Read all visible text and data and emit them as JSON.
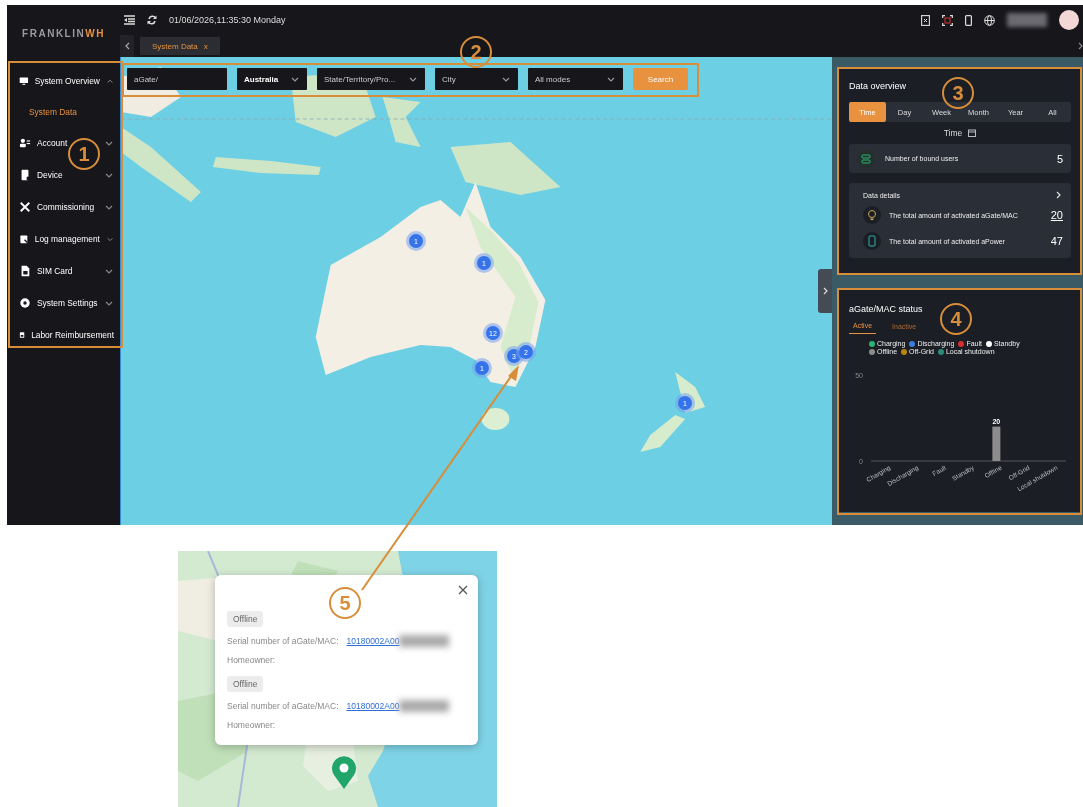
{
  "header": {
    "logo_text": "FRANKLIN",
    "logo_accent": "WH",
    "datetime": "01/06/2026,11:35:30 Monday"
  },
  "tabs": [
    {
      "label": "System Data",
      "close": "x",
      "selected": true
    }
  ],
  "sidebar": {
    "items": [
      {
        "kind": "monitor",
        "label": "System Overview",
        "expanded": true,
        "children": [
          {
            "label": "System Data",
            "selected": true
          }
        ]
      },
      {
        "kind": "account",
        "label": "Account",
        "expanded": false
      },
      {
        "kind": "device",
        "label": "Device",
        "expanded": false
      },
      {
        "kind": "tools",
        "label": "Commissioning",
        "expanded": false
      },
      {
        "kind": "log",
        "label": "Log management",
        "expanded": false
      },
      {
        "kind": "sim",
        "label": "SIM Card",
        "expanded": false
      },
      {
        "kind": "gear",
        "label": "System Settings",
        "expanded": false
      },
      {
        "kind": "receipt",
        "label": "Labor Reimbursement"
      }
    ]
  },
  "filters": {
    "search": {
      "value": "aGate/"
    },
    "selects": [
      {
        "value": "Australia"
      },
      {
        "placeholder": "State/Territory/Pro..."
      },
      {
        "placeholder": "City"
      },
      {
        "placeholder": "All modes"
      }
    ],
    "button": "Search"
  },
  "map": {
    "clusters": [
      {
        "count": "1"
      },
      {
        "count": "1"
      },
      {
        "count": "12"
      },
      {
        "count": "3"
      },
      {
        "count": "2"
      },
      {
        "count": "1"
      },
      {
        "count": "1"
      }
    ]
  },
  "data_overview": {
    "title": "Data overview",
    "periods": [
      {
        "label": "Time",
        "selected": true
      },
      {
        "label": "Day",
        "selected": false
      },
      {
        "label": "Week",
        "selected": false
      },
      {
        "label": "Month",
        "selected": false
      },
      {
        "label": "Year",
        "selected": false
      },
      {
        "label": "All",
        "selected": false
      }
    ],
    "period_label": "Time",
    "bound_users": {
      "label": "Number of bound users",
      "value": "5"
    },
    "details": {
      "title": "Data details",
      "rows": [
        {
          "kind": "agate",
          "label": "The total amount of activated aGate/MAC",
          "value": "20",
          "link": true
        },
        {
          "kind": "apower",
          "label": "The total amount of activated aPower",
          "value": "47",
          "link": false
        }
      ]
    }
  },
  "status": {
    "title": "aGate/MAC status",
    "tabs": [
      {
        "label": "Active",
        "selected": true
      },
      {
        "label": "Inactive",
        "selected": false
      }
    ],
    "legend": [
      {
        "label": "Charging",
        "color": "#2bb673"
      },
      {
        "label": "Discharging",
        "color": "#3b7ddd"
      },
      {
        "label": "Fault",
        "color": "#e02b2b"
      },
      {
        "label": "Standby",
        "color": "#ffffff"
      },
      {
        "label": "Offline",
        "color": "#8c8c8c"
      },
      {
        "label": "Off-Grid",
        "color": "#b8860b"
      },
      {
        "label": "Local shutdown",
        "color": "#2e8b7a"
      }
    ],
    "chart_data": {
      "type": "bar",
      "categories": [
        "Charging",
        "Discharging",
        "Fault",
        "Standby",
        "Offline",
        "Off-Grid",
        "Local shutdown"
      ],
      "values": [
        0,
        0,
        0,
        0,
        20,
        0,
        0
      ],
      "ylim": [
        0,
        50
      ],
      "yticks": [
        0,
        50
      ],
      "value_labels": [
        null,
        null,
        null,
        null,
        "20",
        null,
        null
      ]
    }
  },
  "popup": {
    "entries": [
      {
        "status": "Offline",
        "serial_label": "Serial number of aGate/MAC:",
        "serial": "10180002A00",
        "homeowner_label": "Homeowner:"
      },
      {
        "status": "Offline",
        "serial_label": "Serial number of aGate/MAC:",
        "serial": "10180002A00",
        "homeowner_label": "Homeowner:"
      }
    ]
  },
  "callouts": [
    {
      "label": "1"
    },
    {
      "label": "2"
    },
    {
      "label": "3"
    },
    {
      "label": "4"
    },
    {
      "label": "5"
    }
  ]
}
